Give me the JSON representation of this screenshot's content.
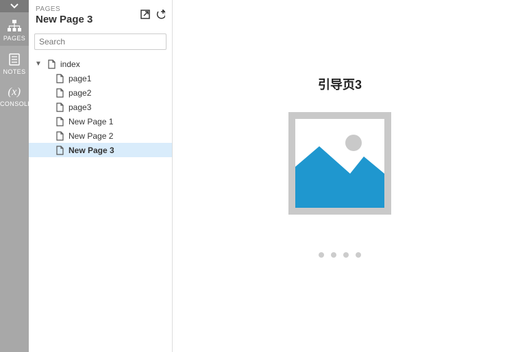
{
  "rail": {
    "items": [
      {
        "label": "PAGES"
      },
      {
        "label": "NOTES"
      },
      {
        "label": "CONSOLE"
      }
    ]
  },
  "panel": {
    "section_label": "PAGES",
    "title": "New Page 3",
    "search_placeholder": "Search"
  },
  "tree": {
    "root": {
      "label": "index"
    },
    "children": [
      {
        "label": "page1"
      },
      {
        "label": "page2"
      },
      {
        "label": "page3"
      },
      {
        "label": "New Page 1"
      },
      {
        "label": "New Page 2"
      },
      {
        "label": "New Page 3",
        "selected": true
      }
    ]
  },
  "canvas": {
    "title": "引导页3",
    "dots_count": 4,
    "image_fill": "#1f97cf",
    "placeholder_frame": "#c9c9c9"
  }
}
